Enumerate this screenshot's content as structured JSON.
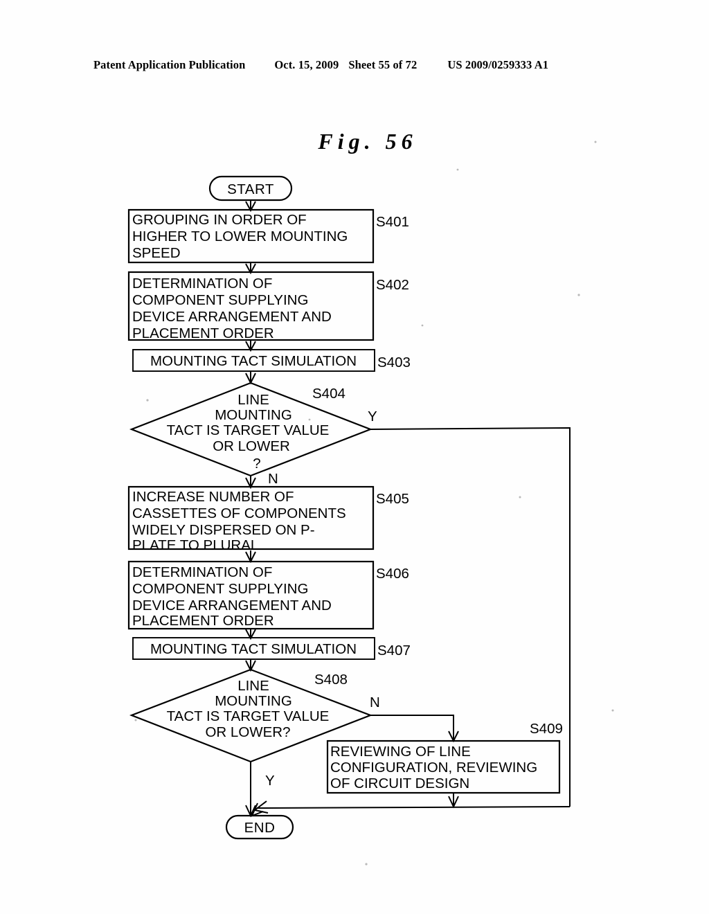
{
  "header": {
    "publication": "Patent Application Publication",
    "date": "Oct. 15, 2009",
    "sheet": "Sheet 55 of 72",
    "number": "US 2009/0259333 A1"
  },
  "figure": {
    "title": "Fig. 56"
  },
  "flowchart": {
    "start_label": "START",
    "end_label": "END",
    "nodes": [
      {
        "id": "S401",
        "type": "process",
        "step": "S401",
        "lines": [
          "GROUPING IN ORDER OF",
          "HIGHER TO LOWER MOUNTING",
          "SPEED"
        ]
      },
      {
        "id": "S402",
        "type": "process",
        "step": "S402",
        "lines": [
          "DETERMINATION OF",
          "COMPONENT SUPPLYING",
          "DEVICE ARRANGEMENT AND",
          "PLACEMENT ORDER"
        ]
      },
      {
        "id": "S403",
        "type": "process",
        "step": "S403",
        "lines": [
          "MOUNTING TACT SIMULATION"
        ]
      },
      {
        "id": "S404",
        "type": "decision",
        "step": "S404",
        "lines": [
          "LINE",
          "MOUNTING",
          "TACT IS TARGET VALUE",
          "OR LOWER",
          "?"
        ],
        "yes_label": "Y",
        "no_label": "N"
      },
      {
        "id": "S405",
        "type": "process",
        "step": "S405",
        "lines": [
          "INCREASE NUMBER OF",
          "CASSETTES OF COMPONENTS",
          "WIDELY DISPERSED ON P-",
          "PLATE TO PLURAL"
        ]
      },
      {
        "id": "S406",
        "type": "process",
        "step": "S406",
        "lines": [
          "DETERMINATION OF",
          "COMPONENT SUPPLYING",
          "DEVICE ARRANGEMENT AND",
          "PLACEMENT ORDER"
        ]
      },
      {
        "id": "S407",
        "type": "process",
        "step": "S407",
        "lines": [
          "MOUNTING TACT SIMULATION"
        ]
      },
      {
        "id": "S408",
        "type": "decision",
        "step": "S408",
        "lines": [
          "LINE",
          "MOUNTING",
          "TACT IS TARGET VALUE",
          "OR LOWER?"
        ],
        "yes_label": "Y",
        "no_label": "N"
      },
      {
        "id": "S409",
        "type": "process",
        "step": "S409",
        "lines": [
          "REVIEWING OF LINE",
          "CONFIGURATION, REVIEWING",
          "OF CIRCUIT DESIGN"
        ]
      }
    ]
  },
  "colors": {
    "ink": "#000000",
    "paper": "#ffffff"
  }
}
